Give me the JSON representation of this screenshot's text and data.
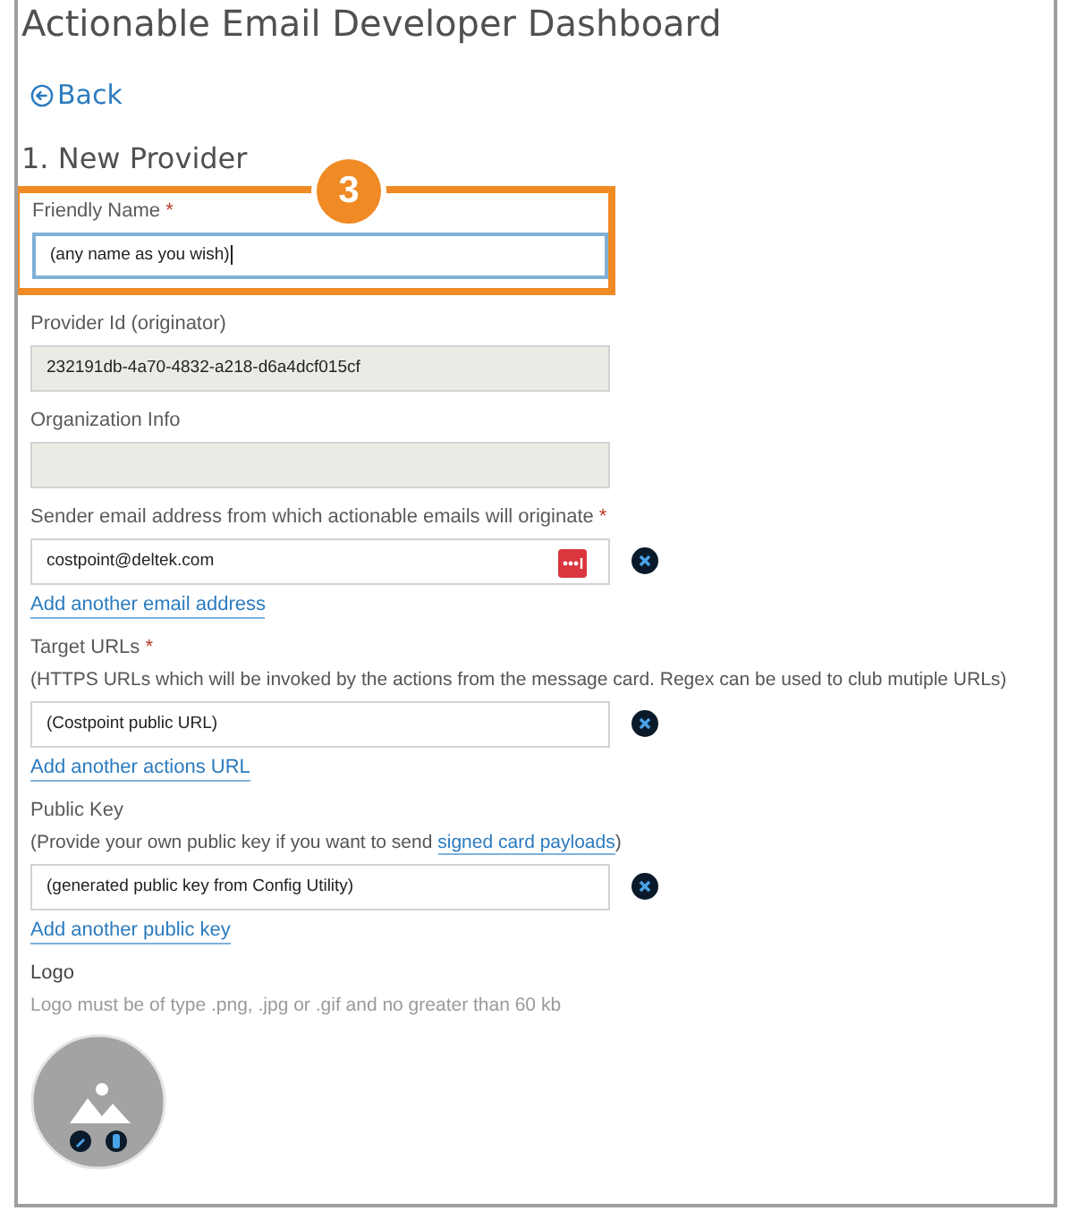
{
  "title": "Actionable Email Developer Dashboard",
  "back": {
    "label": "Back"
  },
  "section_title": "1. New Provider",
  "callout": {
    "number": "3"
  },
  "fields": [
    {
      "kind": "input",
      "label": "Friendly Name",
      "required_mark": "*",
      "value": "(any name as you wish)",
      "focused": true,
      "highlighted": true
    },
    {
      "kind": "readonly",
      "label": "Provider Id (originator)",
      "value": "232191db-4a70-4832-a218-d6a4dcf015cf",
      "focused": false,
      "highlighted": false
    },
    {
      "kind": "readonly",
      "label": "Organization Info",
      "focused": false,
      "highlighted": false
    },
    {
      "kind": "removable",
      "label": "Sender email address from which actionable emails will originate",
      "required_mark": "*",
      "value": "costpoint@deltek.com",
      "password_manager": true,
      "add_link": "Add another email address",
      "focused": false,
      "highlighted": false
    },
    {
      "kind": "removable",
      "label": "Target URLs",
      "required_mark": "*",
      "description": "(HTTPS URLs which will be invoked by the actions from the message card. Regex can be used to club mutiple URLs)",
      "value": "(Costpoint public URL)",
      "password_manager": false,
      "add_link": "Add another actions URL",
      "focused": false,
      "highlighted": false
    },
    {
      "kind": "removable",
      "label": "Public Key",
      "description": "(Provide your own public key if you want to send ",
      "description_link": "signed card payloads",
      "description_end": ")",
      "value": "(generated public key from Config Utility)",
      "password_manager": false,
      "add_link": "Add another public key",
      "focused": false,
      "highlighted": false
    },
    {
      "kind": "logo",
      "label": "Logo",
      "description": "Logo must be of type .png, .jpg or .gif and no greater than 60 kb",
      "highlighted": false
    }
  ]
}
